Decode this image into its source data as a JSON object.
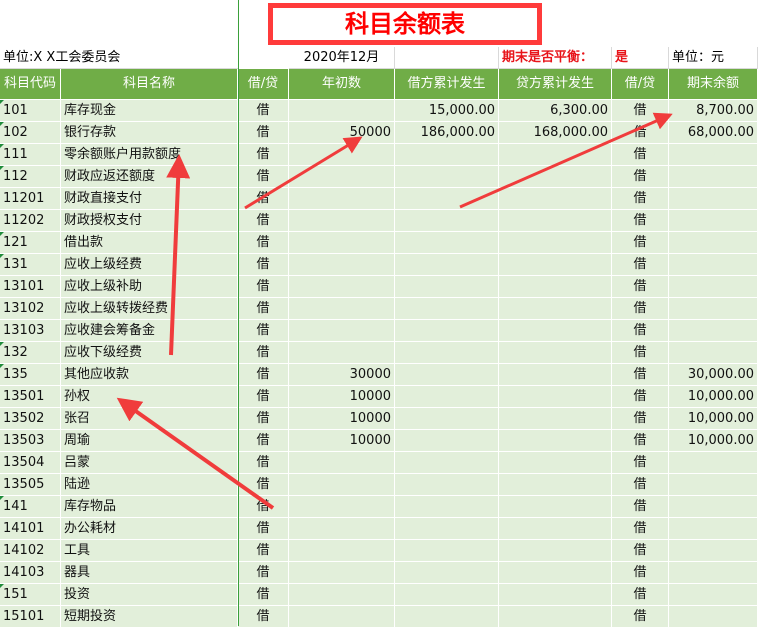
{
  "title": "科目余额表",
  "info": {
    "unit": "单位:X X工会委员会",
    "period": "2020年12月",
    "balance_label": "期末是否平衡：",
    "balance_value": "是",
    "currency": "单位：元"
  },
  "headers": [
    "科目代码",
    "科目名称",
    "借/贷",
    "年初数",
    "借方累计发生",
    "贷方累计发生",
    "借/贷",
    "期末余额"
  ],
  "rows": [
    [
      "101",
      "库存现金",
      "借",
      "",
      "15,000.00",
      "6,300.00",
      "借",
      "8,700.00"
    ],
    [
      "102",
      "银行存款",
      "借",
      "50000",
      "186,000.00",
      "168,000.00",
      "借",
      "68,000.00"
    ],
    [
      "111",
      "零余额账户用款额度",
      "借",
      "",
      "",
      "",
      "借",
      ""
    ],
    [
      "112",
      "财政应返还额度",
      "借",
      "",
      "",
      "",
      "借",
      ""
    ],
    [
      "11201",
      "财政直接支付",
      "借",
      "",
      "",
      "",
      "借",
      ""
    ],
    [
      "11202",
      "财政授权支付",
      "借",
      "",
      "",
      "",
      "借",
      ""
    ],
    [
      "121",
      "借出款",
      "借",
      "",
      "",
      "",
      "借",
      ""
    ],
    [
      "131",
      "应收上级经费",
      "借",
      "",
      "",
      "",
      "借",
      ""
    ],
    [
      "13101",
      "应收上级补助",
      "借",
      "",
      "",
      "",
      "借",
      ""
    ],
    [
      "13102",
      "应收上级转拨经费",
      "借",
      "",
      "",
      "",
      "借",
      ""
    ],
    [
      "13103",
      "应收建会筹备金",
      "借",
      "",
      "",
      "",
      "借",
      ""
    ],
    [
      "132",
      "应收下级经费",
      "借",
      "",
      "",
      "",
      "借",
      ""
    ],
    [
      "135",
      "其他应收款",
      "借",
      "30000",
      "",
      "",
      "借",
      "30,000.00"
    ],
    [
      "13501",
      "孙权",
      "借",
      "10000",
      "",
      "",
      "借",
      "10,000.00"
    ],
    [
      "13502",
      "张召",
      "借",
      "10000",
      "",
      "",
      "借",
      "10,000.00"
    ],
    [
      "13503",
      "周瑜",
      "借",
      "10000",
      "",
      "",
      "借",
      "10,000.00"
    ],
    [
      "13504",
      "吕蒙",
      "借",
      "",
      "",
      "",
      "借",
      ""
    ],
    [
      "13505",
      "陆逊",
      "借",
      "",
      "",
      "",
      "借",
      ""
    ],
    [
      "141",
      "库存物品",
      "借",
      "",
      "",
      "",
      "借",
      ""
    ],
    [
      "14101",
      "办公耗材",
      "借",
      "",
      "",
      "",
      "借",
      ""
    ],
    [
      "14102",
      "工具",
      "借",
      "",
      "",
      "",
      "借",
      ""
    ],
    [
      "14103",
      "器具",
      "借",
      "",
      "",
      "",
      "借",
      ""
    ],
    [
      "151",
      "投资",
      "借",
      "",
      "",
      "",
      "借",
      ""
    ],
    [
      "15101",
      "短期投资",
      "借",
      "",
      "",
      "",
      "借",
      ""
    ]
  ],
  "colors": {
    "header": "#70ad47",
    "row": "#e2efda",
    "accent": "#ff3b3b"
  }
}
